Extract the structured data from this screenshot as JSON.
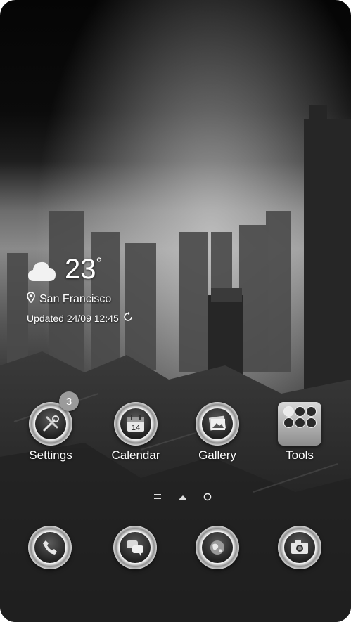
{
  "weather": {
    "temperature": "23",
    "degree_symbol": "°",
    "condition_icon": "cloud-icon",
    "location": "San Francisco",
    "updated": "Updated 24/09 12:45"
  },
  "apps": [
    {
      "label": "Settings",
      "icon": "tools-wrench-icon",
      "badge": "3"
    },
    {
      "label": "Calendar",
      "icon": "calendar-icon",
      "date": "14"
    },
    {
      "label": "Gallery",
      "icon": "photos-icon"
    },
    {
      "label": "Tools",
      "icon": "tools-folder-icon"
    }
  ],
  "pager": {
    "current_page": 2,
    "total_pages": 3
  },
  "dock": [
    {
      "name": "phone",
      "icon": "phone-icon"
    },
    {
      "name": "messages",
      "icon": "chat-icon"
    },
    {
      "name": "browser",
      "icon": "globe-icon"
    },
    {
      "name": "camera",
      "icon": "camera-icon"
    }
  ]
}
